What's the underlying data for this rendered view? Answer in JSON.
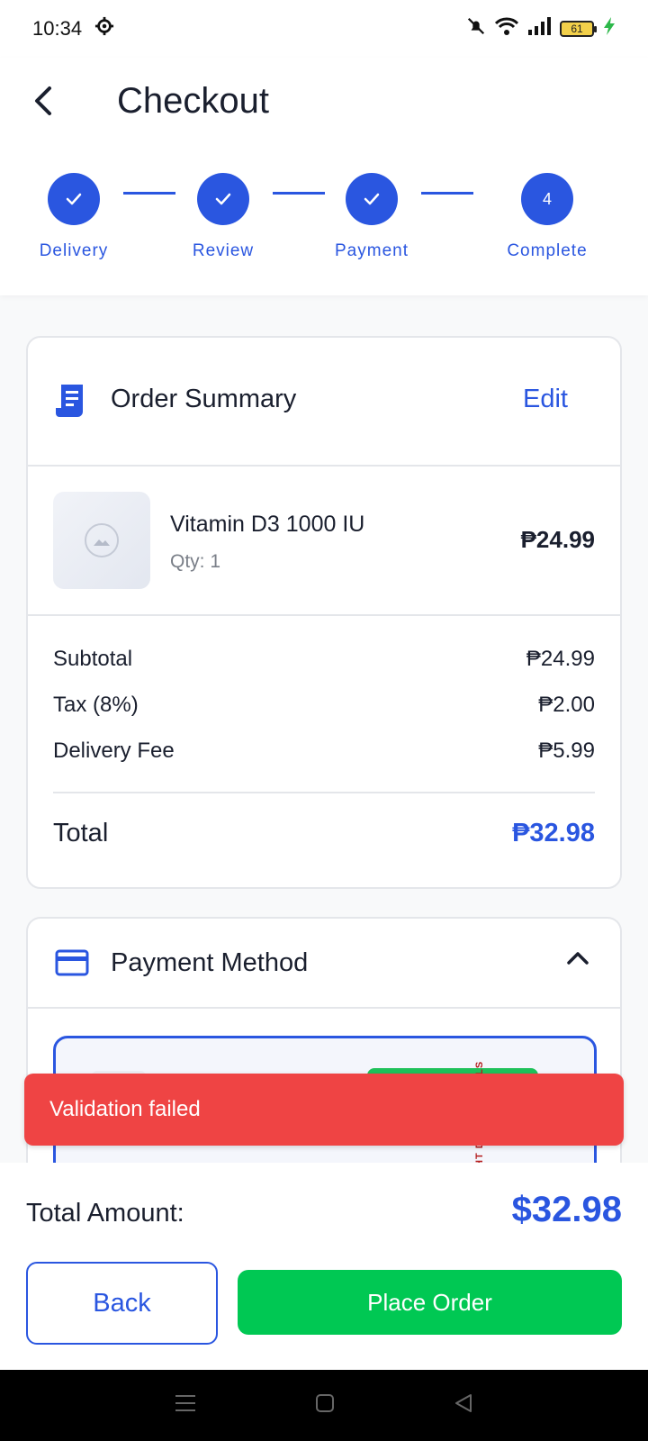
{
  "status_bar": {
    "time": "10:34",
    "battery": "61",
    "icons": [
      "gear-icon",
      "mute-icon",
      "wifi-icon",
      "signal-icon",
      "battery-icon",
      "charging-icon"
    ]
  },
  "header": {
    "title": "Checkout",
    "back_icon": "back-arrow-icon"
  },
  "stepper": {
    "steps": [
      {
        "label": "Delivery",
        "state": "done"
      },
      {
        "label": "Review",
        "state": "done"
      },
      {
        "label": "Payment",
        "state": "done"
      },
      {
        "label": "Complete",
        "state": "current",
        "number": "4"
      }
    ]
  },
  "order_summary": {
    "title": "Order Summary",
    "edit_label": "Edit",
    "item": {
      "name": "Vitamin D3 1000 IU",
      "qty": "Qty: 1",
      "price": "₱24.99"
    },
    "rows": [
      {
        "label": "Subtotal",
        "value": "₱24.99"
      },
      {
        "label": "Tax (8%)",
        "value": "₱2.00"
      },
      {
        "label": "Delivery Fee",
        "value": "₱5.99"
      }
    ],
    "total_label": "Total",
    "total_value": "₱32.98"
  },
  "payment_method": {
    "title": "Payment Method",
    "debug_text": "HT                D BY 30 PIXELS"
  },
  "toast": {
    "message": "Validation failed"
  },
  "bottom_bar": {
    "total_label": "Total Amount:",
    "total_value": "$32.98",
    "back_label": "Back",
    "place_order_label": "Place Order"
  },
  "colors": {
    "accent": "#2a56e0",
    "error": "#ef4444",
    "success": "#00c853"
  }
}
